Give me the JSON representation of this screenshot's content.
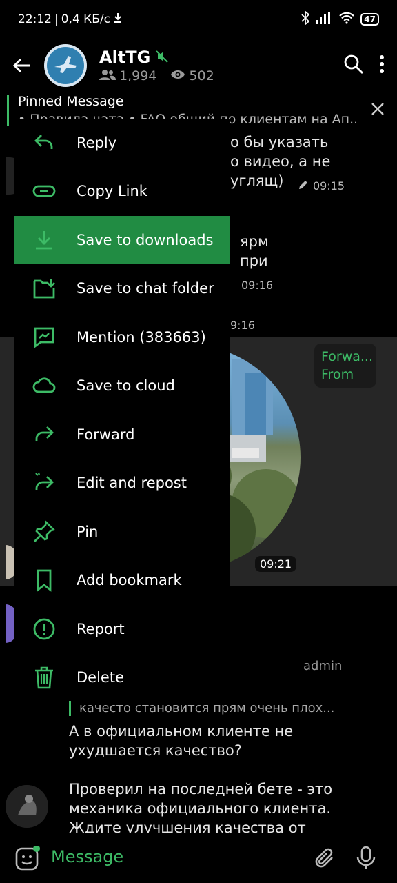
{
  "status": {
    "time": "22:12",
    "speed": "0,4 КБ/с",
    "battery": "47"
  },
  "header": {
    "title": "AltTG",
    "subscribers": "1,994",
    "online": "502"
  },
  "pinned": {
    "title": "Pinned Message",
    "text": "• Правила чата • FAQ общий по клиентам на Ап..."
  },
  "chat_bg": {
    "line1": "о бы указать",
    "line2": "о видео, а не",
    "line3": "углящ)",
    "time1": "09:15",
    "line4": "ярм",
    "line5": "при",
    "time2": "09:16",
    "time3": "9:16",
    "video_time": "09:21",
    "forward_line1": "Forwa...",
    "forward_line2": "From"
  },
  "menu": {
    "items": [
      {
        "label": "Reply",
        "icon": "reply-icon"
      },
      {
        "label": "Copy Link",
        "icon": "link-icon"
      },
      {
        "label": "Save to downloads",
        "icon": "download-icon"
      },
      {
        "label": "Save to chat folder",
        "icon": "folder-download-icon"
      },
      {
        "label": "Mention (383663)",
        "icon": "mention-icon"
      },
      {
        "label": "Save to cloud",
        "icon": "cloud-icon"
      },
      {
        "label": "Forward",
        "icon": "forward-icon"
      },
      {
        "label": "Edit and repost",
        "icon": "edit-repost-icon"
      },
      {
        "label": "Pin",
        "icon": "pin-icon"
      },
      {
        "label": "Add bookmark",
        "icon": "bookmark-icon"
      },
      {
        "label": "Report",
        "icon": "report-icon"
      },
      {
        "label": "Delete",
        "icon": "trash-icon"
      }
    ]
  },
  "lower_chat": {
    "admin": "admin",
    "quote": "качесто становится прям очень плох...",
    "msg1_line1": "А в официальном клиенте не",
    "msg1_line2": "ухудшается качество?",
    "msg2_line1": "Проверил на последней бете - это",
    "msg2_line2": "механика официального клиента.",
    "msg2_line3": "Ждите улучшения качества от"
  },
  "input": {
    "placeholder": "Message"
  },
  "colors": {
    "accent": "#3dbb66",
    "active": "#218c43"
  }
}
